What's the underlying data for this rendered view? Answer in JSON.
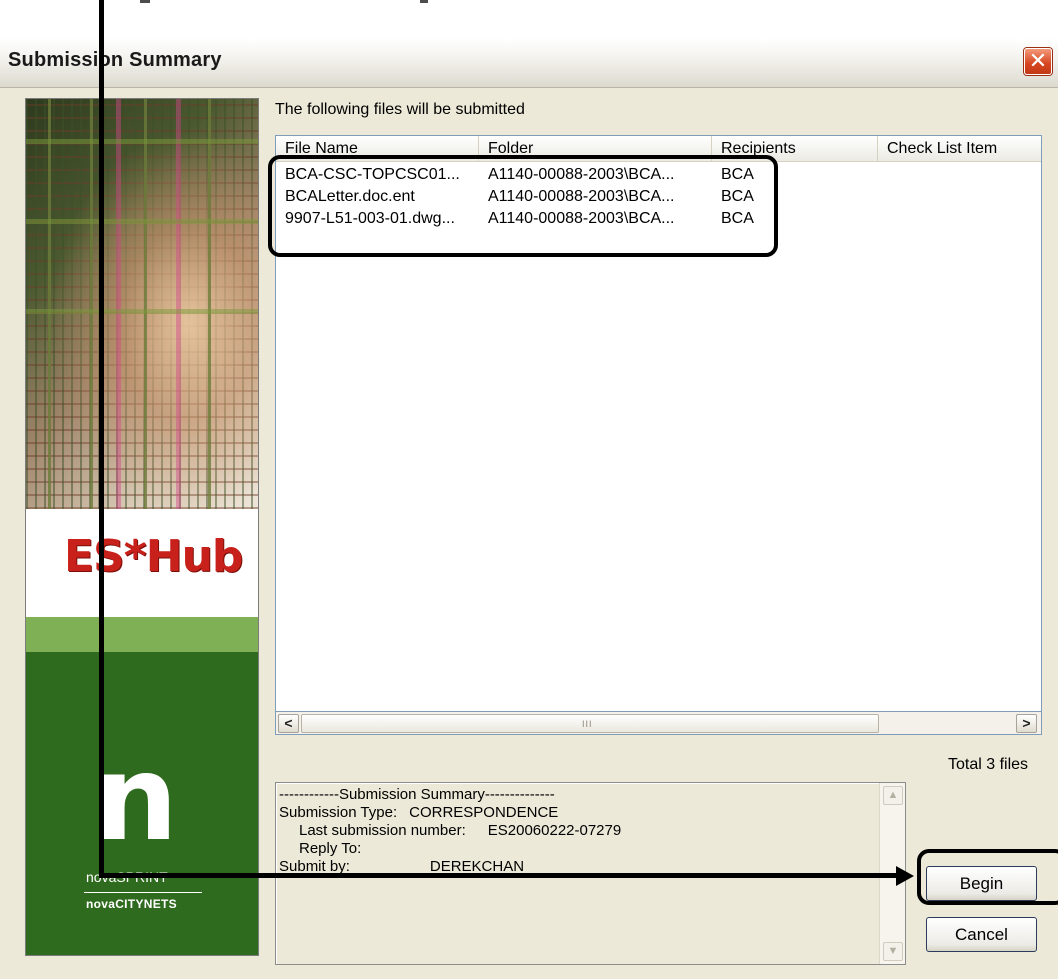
{
  "window": {
    "title": "Submission Summary",
    "close_glyph": "✕"
  },
  "banner": {
    "logo": "ES*Hub",
    "letter": "n",
    "brand_primary": "novaSPRINT",
    "brand_secondary": "novaCITYNETS"
  },
  "files": {
    "caption": "The following files will be submitted",
    "columns": [
      "File Name",
      "Folder",
      "Recipients",
      "Check List Item"
    ],
    "rows": [
      {
        "name": "BCA-CSC-TOPCSC01...",
        "folder": "A1140-00088-2003\\BCA...",
        "recipient": "BCA",
        "checklist": ""
      },
      {
        "name": "BCALetter.doc.ent",
        "folder": "A1140-00088-2003\\BCA...",
        "recipient": "BCA",
        "checklist": ""
      },
      {
        "name": "9907-L51-003-01.dwg...",
        "folder": "A1140-00088-2003\\BCA...",
        "recipient": "BCA",
        "checklist": ""
      }
    ],
    "scroll_left": "<",
    "scroll_right": ">",
    "scroll_grip": "III",
    "total": "Total 3 files"
  },
  "summary": {
    "header": "------------Submission Summary--------------",
    "type_label": "Submission Type:",
    "type_value": "CORRESPONDENCE",
    "last_label": "Last submission number:",
    "last_value": "ES20060222-07279",
    "reply_label": "Reply To:",
    "submit_label": "Submit by:",
    "submit_value": "DEREKCHAN",
    "scroll_up": "▲",
    "scroll_down": "▼"
  },
  "buttons": {
    "begin": "Begin",
    "cancel": "Cancel"
  },
  "colors": {
    "accent_red": "#c8201a",
    "banner_green": "#2f6b1e",
    "window_bg": "#ece9d8"
  }
}
